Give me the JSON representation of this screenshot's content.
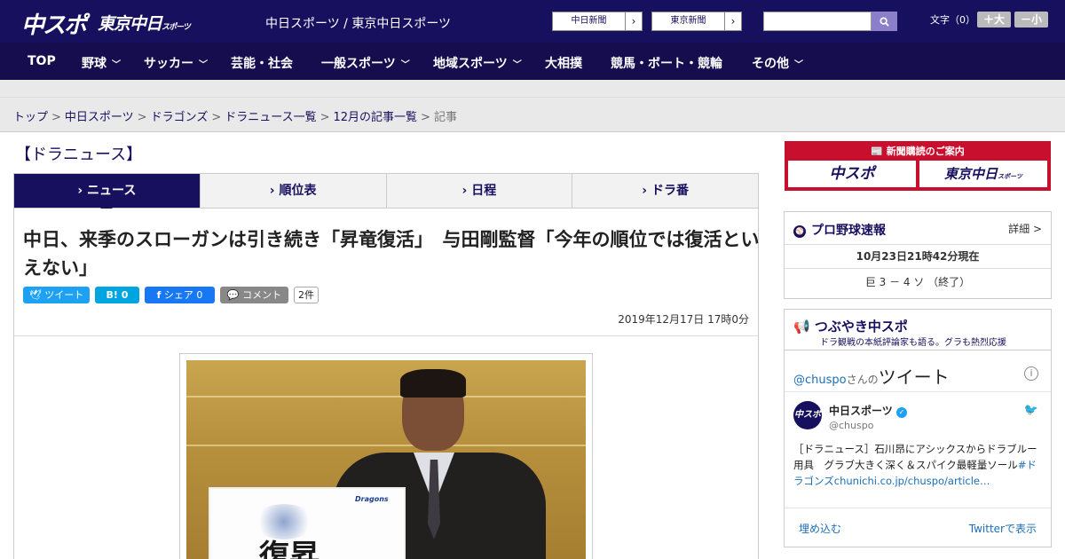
{
  "header": {
    "logo_chuspo": "中スポ",
    "logo_tokyo": "東京中日",
    "logo_tokyo_suffix": "スポーツ",
    "site_name": "中日スポーツ / 東京中日スポーツ",
    "ext_links": [
      {
        "label": "中日新聞"
      },
      {
        "label": "東京新聞"
      }
    ],
    "search_placeholder": "",
    "font_size_label": "文字（0）",
    "font_larger": "＋大",
    "font_smaller": "－小"
  },
  "nav": [
    {
      "label": "TOP",
      "dropdown": false
    },
    {
      "label": "野球",
      "dropdown": true
    },
    {
      "label": "サッカー",
      "dropdown": true
    },
    {
      "label": "芸能・社会",
      "dropdown": false
    },
    {
      "label": "一般スポーツ",
      "dropdown": true
    },
    {
      "label": "地域スポーツ",
      "dropdown": true
    },
    {
      "label": "大相撲",
      "dropdown": false
    },
    {
      "label": "競馬・ボート・競輪",
      "dropdown": false
    },
    {
      "label": "その他",
      "dropdown": true
    }
  ],
  "breadcrumb": {
    "items": [
      "トップ",
      "中日スポーツ",
      "ドラゴンズ",
      "ドラニュース一覧",
      "12月の記事一覧"
    ],
    "current": "記事",
    "separator": ">"
  },
  "section_title": "【ドラニュース】",
  "tabs": [
    {
      "label": "ニュース",
      "active": true
    },
    {
      "label": "順位表",
      "active": false
    },
    {
      "label": "日程",
      "active": false
    },
    {
      "label": "ドラ番",
      "active": false
    }
  ],
  "article": {
    "headline": "中日、来季のスローガンは引き続き「昇竜復活」　与田剛監督「今年の順位では復活といえない」",
    "share": {
      "tweet": "ツイート",
      "hatena": "B!",
      "hatena_count": "0",
      "facebook": "シェア",
      "facebook_count": "0",
      "comment": "コメント",
      "comment_count": "2件"
    },
    "published": "2019年12月17日 17時0分",
    "photo": {
      "board_text": "復昇",
      "board_logo": "Dragons"
    }
  },
  "sidebar": {
    "subscribe": {
      "title": "新聞購読のご案内",
      "options": [
        "中スポ",
        "東京中日"
      ],
      "tokyo_suffix": "スポーツ"
    },
    "baseball": {
      "title": "プロ野球速報",
      "detail_link": "詳細 >",
      "timestamp": "10月23日21時42分現在",
      "score": "巨 3 － 4 ソ （終了）"
    },
    "tsubuyaki": {
      "title": "つぶやき中スポ",
      "subtitle": "ドラ観戦の本紙評論家も語る。グラも熱烈応援"
    },
    "twitter": {
      "handle_link": "@chuspo",
      "handle_suffix": "さんの",
      "title": "ツイート",
      "account_name": "中日スポーツ",
      "account_handle": "@chuspo",
      "tweet_text": "［ドラニュース］石川昂にアシックスからドラブルー用具　グラブ大きく深く＆スパイク最軽量ソール",
      "tweet_hashtag": "#ドラゴンズ",
      "tweet_link": "chunichi.co.jp/chuspo/article…",
      "embed": "埋め込む",
      "view_on_twitter": "Twitterで表示"
    }
  },
  "colors": {
    "brand_navy": "#17105e",
    "nav_navy": "#150d4e",
    "subscribe_red": "#c8102e",
    "twitter_blue": "#1da1f2",
    "hatena_blue": "#00a4de",
    "facebook_blue": "#1877f2",
    "comment_gray": "#888888"
  }
}
